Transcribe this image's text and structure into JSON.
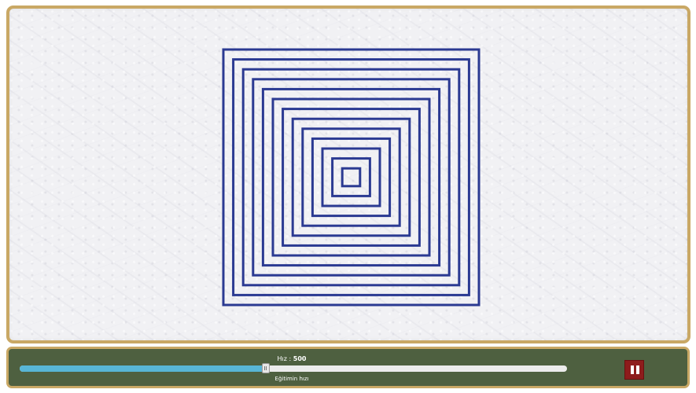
{
  "canvas": {
    "line_color": "#2b3a92",
    "square_count": 13
  },
  "controls": {
    "speed_label": "Hız :",
    "speed_value": "500",
    "slider_label": "Eğitimin hızı",
    "slider_fraction": 0.45,
    "slider_fill_color": "#58b6d6",
    "pause_button_color": "#8e1c1c",
    "pause_icon": "pause-icon"
  }
}
